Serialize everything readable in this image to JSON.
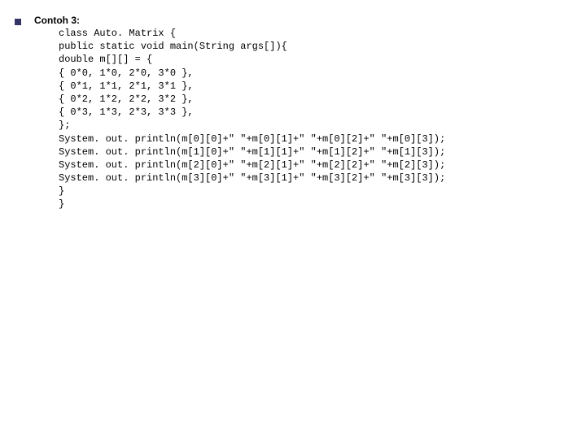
{
  "title": "Contoh 3:",
  "code": {
    "l01": "class Auto. Matrix {",
    "l02": "public static void main(String args[]){",
    "l03": "double m[][] = {",
    "l04": "{ 0*0, 1*0, 2*0, 3*0 },",
    "l05": "{ 0*1, 1*1, 2*1, 3*1 },",
    "l06": "{ 0*2, 1*2, 2*2, 3*2 },",
    "l07": "{ 0*3, 1*3, 2*3, 3*3 },",
    "l08": "};",
    "l09": "System. out. println(m[0][0]+\" \"+m[0][1]+\" \"+m[0][2]+\" \"+m[0][3]);",
    "l10": "System. out. println(m[1][0]+\" \"+m[1][1]+\" \"+m[1][2]+\" \"+m[1][3]);",
    "l11": "System. out. println(m[2][0]+\" \"+m[2][1]+\" \"+m[2][2]+\" \"+m[2][3]);",
    "l12": "System. out. println(m[3][0]+\" \"+m[3][1]+\" \"+m[3][2]+\" \"+m[3][3]);",
    "l13": "}",
    "l14": "}"
  }
}
